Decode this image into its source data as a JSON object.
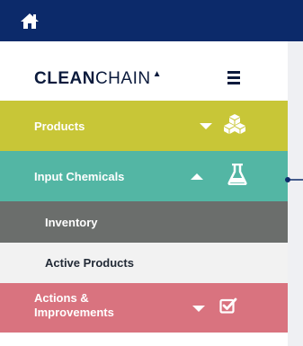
{
  "header": {
    "home_icon": "home-icon",
    "bar_color": "#0c2a6a"
  },
  "brand": {
    "bold_part": "CLEAN",
    "light_part": "CHAIN",
    "caret": "▲"
  },
  "menu_toggle_icon": "hamburger-icon",
  "nav": {
    "products": {
      "label": "Products",
      "color": "#c8c637",
      "arrow": "down",
      "icon": "cubes-icon"
    },
    "input_chemicals": {
      "label": "Input Chemicals",
      "color": "#53b6a4",
      "arrow": "up",
      "icon": "flask-icon",
      "subitems": [
        {
          "label": "Inventory",
          "active": true
        },
        {
          "label": "Active Products",
          "active": false
        }
      ]
    },
    "actions": {
      "label_line1": "Actions &",
      "label_line2": "Improvements",
      "color": "#d9737f",
      "arrow": "down",
      "icon": "checkbox-icon"
    }
  }
}
